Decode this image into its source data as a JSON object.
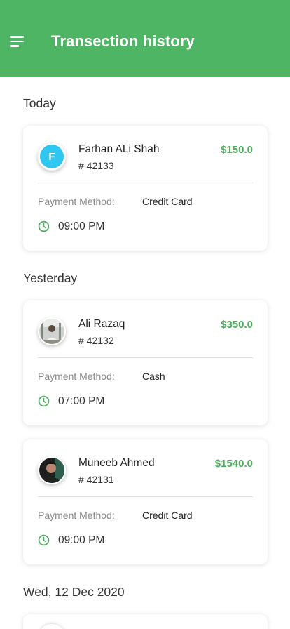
{
  "app_bar": {
    "title": "Transection history",
    "menu_icon": "hamburger-menu-icon",
    "background": "#4db563"
  },
  "sections": [
    {
      "title": "Today",
      "transactions": [
        {
          "name": "Farhan ALi Shah",
          "ref": "# 42133",
          "amount": "$150.0",
          "avatar_letter": "F",
          "payment_method_label": "Payment Method:",
          "payment_method": "Credit Card",
          "time": "09:00 PM"
        }
      ]
    },
    {
      "title": "Yesterday",
      "transactions": [
        {
          "name": "Ali Razaq",
          "ref": "# 42132",
          "amount": "$350.0",
          "payment_method_label": "Payment Method:",
          "payment_method": "Cash",
          "time": "07:00 PM"
        },
        {
          "name": "Muneeb Ahmed",
          "ref": "# 42131",
          "amount": "$1540.0",
          "payment_method_label": "Payment Method:",
          "payment_method": "Credit Card",
          "time": "09:00 PM"
        }
      ]
    },
    {
      "title": "Wed, 12 Dec 2020",
      "transactions": []
    }
  ],
  "colors": {
    "accent": "#4cae5c",
    "avatar_letter_bg": "#2fc6ef"
  }
}
